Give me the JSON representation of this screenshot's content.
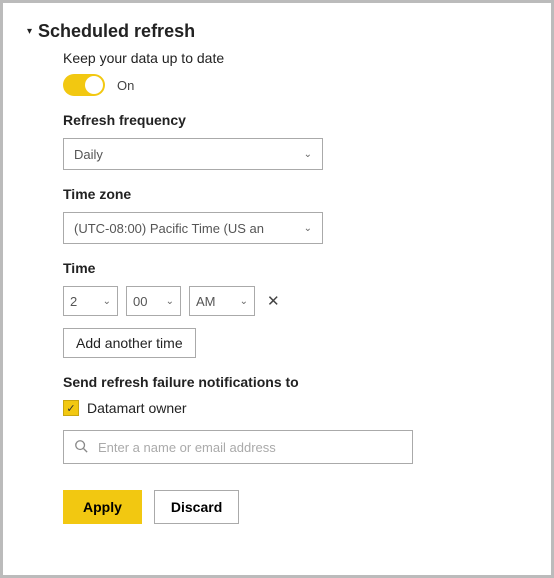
{
  "section": {
    "title": "Scheduled refresh"
  },
  "keepUpToDate": {
    "label": "Keep your data up to date",
    "toggle_state": "On"
  },
  "frequency": {
    "label": "Refresh frequency",
    "value": "Daily"
  },
  "timezone": {
    "label": "Time zone",
    "value": "(UTC-08:00) Pacific Time (US an"
  },
  "time": {
    "label": "Time",
    "hour": "2",
    "minute": "00",
    "ampm": "AM",
    "add_label": "Add another time"
  },
  "notifications": {
    "label": "Send refresh failure notifications to",
    "owner_label": "Datamart owner",
    "placeholder": "Enter a name or email address"
  },
  "buttons": {
    "apply": "Apply",
    "discard": "Discard"
  }
}
